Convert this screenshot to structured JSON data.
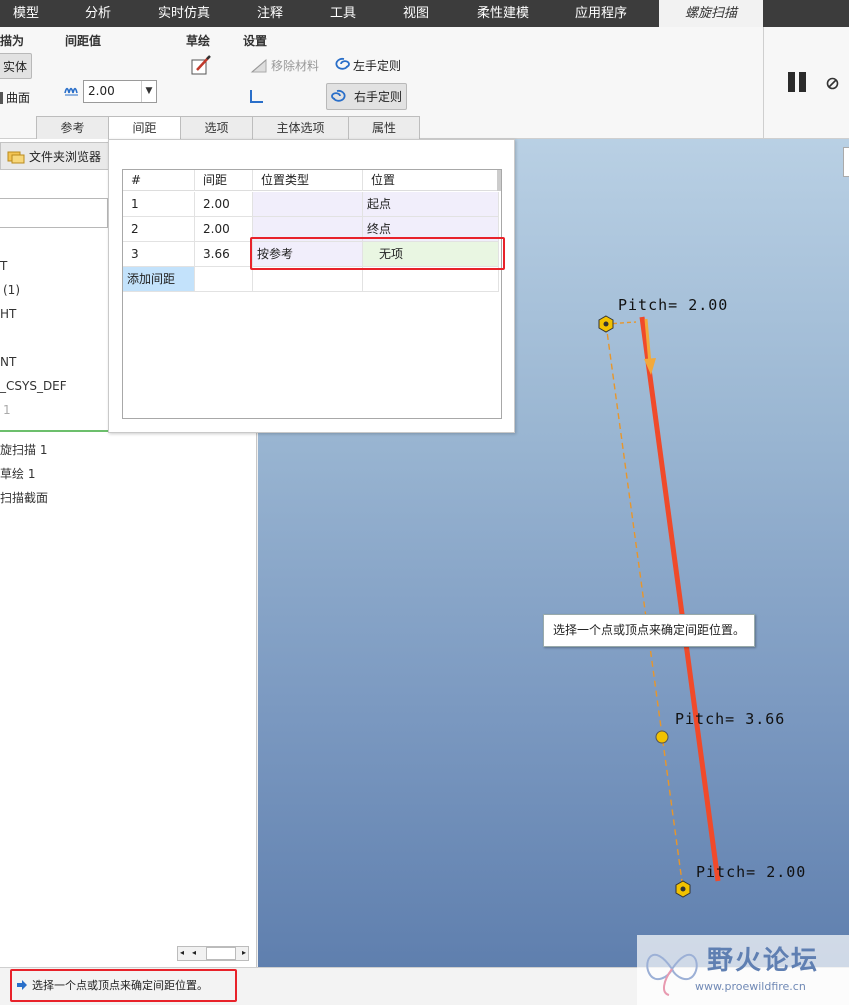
{
  "ribbon_tabs": [
    {
      "label": "模型"
    },
    {
      "label": "分析"
    },
    {
      "label": "实时仿真"
    },
    {
      "label": "注释"
    },
    {
      "label": "工具"
    },
    {
      "label": "视图"
    },
    {
      "label": "柔性建模"
    },
    {
      "label": "应用程序"
    },
    {
      "label": "螺旋扫描",
      "active": true
    }
  ],
  "ribbon": {
    "create_as_label": "描为",
    "solid_label": "实体",
    "surface_label": "曲面",
    "pitch_group_label": "间距值",
    "pitch_value": "2.00",
    "sketch_group_label": "草绘",
    "settings_group_label": "设置",
    "remove_material_label": "移除材料",
    "left_hand_label": "左手定则",
    "right_hand_label": "右手定则"
  },
  "subtabs": [
    {
      "label": "参考"
    },
    {
      "label": "间距",
      "active": true
    },
    {
      "label": "选项"
    },
    {
      "label": "主体选项"
    },
    {
      "label": "属性"
    }
  ],
  "left_panel": {
    "browser_label": "文件夹浏览器",
    "tree_items": [
      {
        "label": "T"
      },
      {
        "label": "(1)"
      },
      {
        "label": "HT"
      },
      {
        "label": "NT"
      },
      {
        "label": "_CSYS_DEF"
      },
      {
        "label": "1"
      },
      {
        "label": "旋扫描 1"
      },
      {
        "label": "草绘 1"
      },
      {
        "label": "扫描截面"
      }
    ]
  },
  "pitch_table": {
    "headers": [
      "#",
      "间距",
      "位置类型",
      "位置"
    ],
    "rows": [
      {
        "index": "1",
        "pitch": "2.00",
        "loc_type": "",
        "location": "起点"
      },
      {
        "index": "2",
        "pitch": "2.00",
        "loc_type": "",
        "location": "终点"
      },
      {
        "index": "3",
        "pitch": "3.66",
        "loc_type": "按参考",
        "location": "无项"
      }
    ],
    "add_pitch_label": "添加间距"
  },
  "viewport": {
    "pitch_label_top": "Pitch= 2.00",
    "pitch_label_mid": "Pitch= 3.66",
    "pitch_label_bottom": "Pitch= 2.00",
    "tooltip": "选择一个点或顶点来确定间距位置。"
  },
  "status_message": "选择一个点或顶点来确定间距位置。",
  "watermark": {
    "title": "野火论坛",
    "url": "www.proewildfire.cn"
  },
  "colors": {
    "accent_red": "#e8222a",
    "helix_red": "#f04a2a",
    "ref_orange": "#e8962a",
    "point_yellow": "#f2c200"
  }
}
